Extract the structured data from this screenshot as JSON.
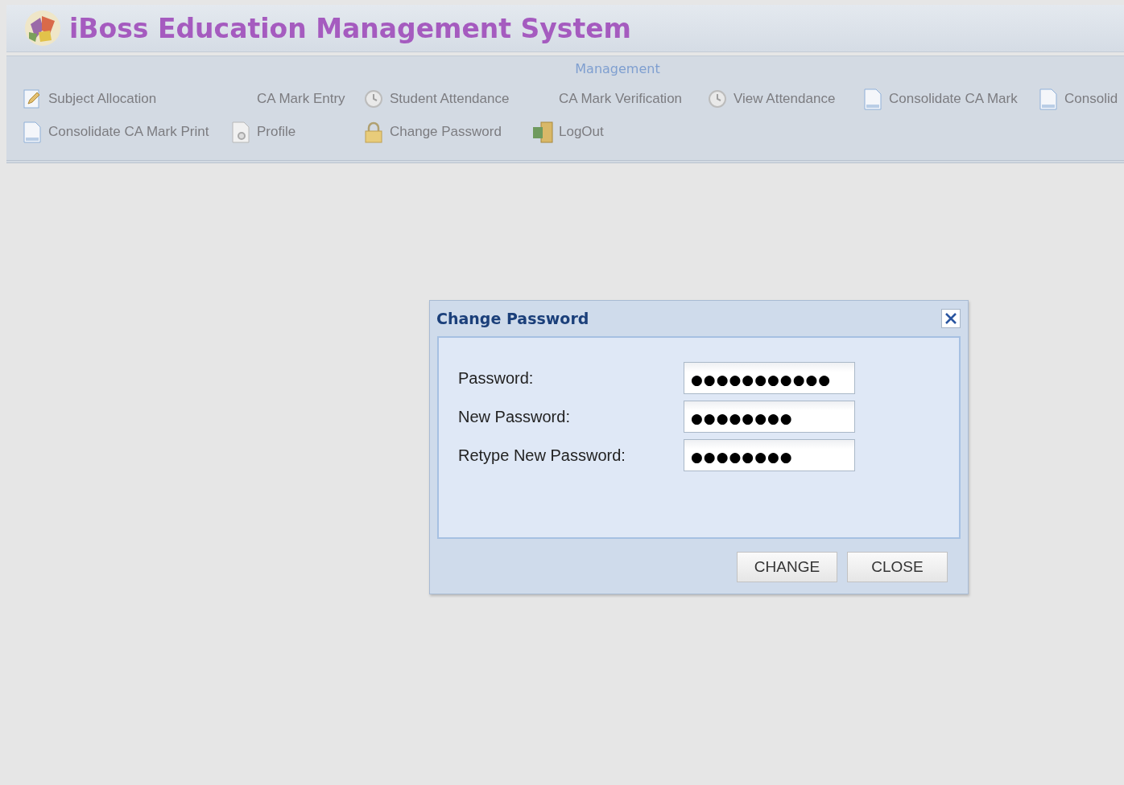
{
  "app_title": "iBoss Education Management System",
  "menu": {
    "title": "Management",
    "rows": [
      [
        {
          "label": "Subject Allocation",
          "kind": "edit"
        },
        {
          "label": "CA Mark Entry",
          "kind": "plain"
        },
        {
          "label": "Student Attendance",
          "kind": "clock"
        },
        {
          "label": "CA Mark Verification",
          "kind": "plain"
        },
        {
          "label": "View Attendance",
          "kind": "clock"
        },
        {
          "label": "Consolidate CA Mark",
          "kind": "doc"
        },
        {
          "label": "Consolid",
          "kind": "doc"
        }
      ],
      [
        {
          "label": "Consolidate CA Mark Print",
          "kind": "doc"
        },
        {
          "label": "Profile",
          "kind": "profile"
        },
        {
          "label": "Change Password",
          "kind": "lock"
        },
        {
          "label": "LogOut",
          "kind": "exit"
        }
      ]
    ]
  },
  "dialog": {
    "title": "Change Password",
    "fields": [
      {
        "label": "Password:",
        "value": "●●●●●●●●●●●"
      },
      {
        "label": "New Password:",
        "value": "●●●●●●●●"
      },
      {
        "label": "Retype New Password:",
        "value": "●●●●●●●●"
      }
    ],
    "buttons": [
      "CHANGE",
      "CLOSE"
    ]
  }
}
